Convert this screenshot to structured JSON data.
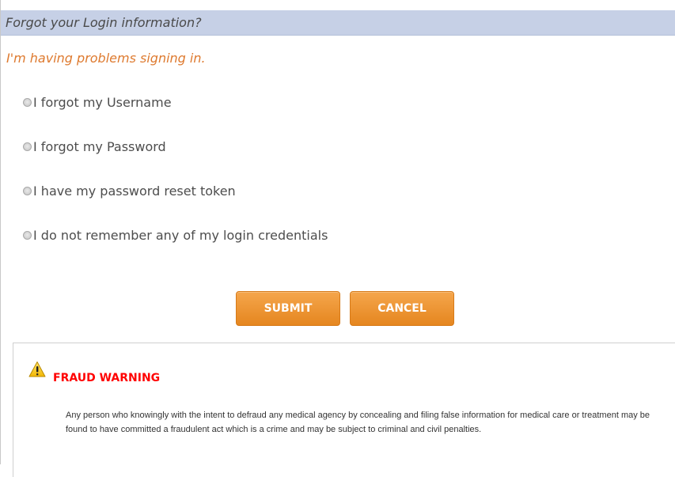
{
  "header": {
    "title": "Forgot your Login information?"
  },
  "subtitle": "I'm having problems signing in.",
  "options": [
    {
      "label": "I forgot my Username",
      "checked": false
    },
    {
      "label": "I forgot my Password",
      "checked": false
    },
    {
      "label": "I have my password reset token",
      "checked": false
    },
    {
      "label": "I do not remember any of my login credentials",
      "checked": false
    }
  ],
  "buttons": {
    "submit": "SUBMIT",
    "cancel": "CANCEL"
  },
  "warning": {
    "icon": "warning-triangle-icon",
    "title": "FRAUD WARNING",
    "text": "Any person who knowingly with the intent to defraud any medical agency by concealing and filing false information for medical care or treatment may be found to have committed a fraudulent act which is a crime and may be subject to criminal and civil penalties."
  },
  "colors": {
    "header_bg": "#c6d0e6",
    "subtitle": "#de7a2f",
    "button": "#e8902d",
    "warning_title": "#ff0000"
  }
}
